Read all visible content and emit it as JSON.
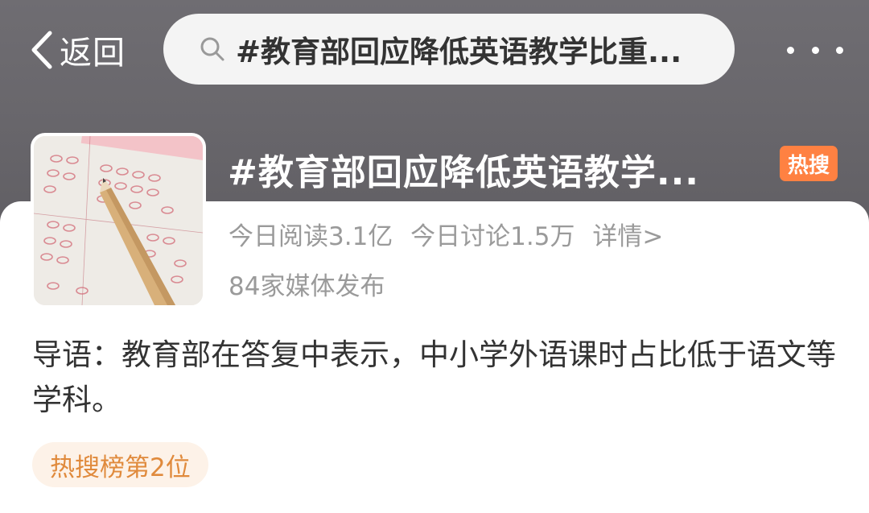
{
  "nav": {
    "back_label": "返回",
    "search_text": "#教育部回应降低英语教学比重...",
    "more_icon": "more-dots-icon"
  },
  "topic": {
    "title": "#教育部回应降低英语教学...",
    "hot_badge": "热搜",
    "read_today": "今日阅读3.1亿",
    "discuss_today": "今日讨论1.5万",
    "detail_link": "详情>",
    "media_count": "84家媒体发布",
    "intro": "导语：教育部在答复中表示，中小学外语课时占比低于语文等学科。",
    "rank": "热搜榜第2位"
  },
  "colors": {
    "header_bg": "#6b696e",
    "hot_badge": "#ff8142",
    "rank_bg": "#fdf2e8",
    "rank_text": "#e08a3c"
  }
}
